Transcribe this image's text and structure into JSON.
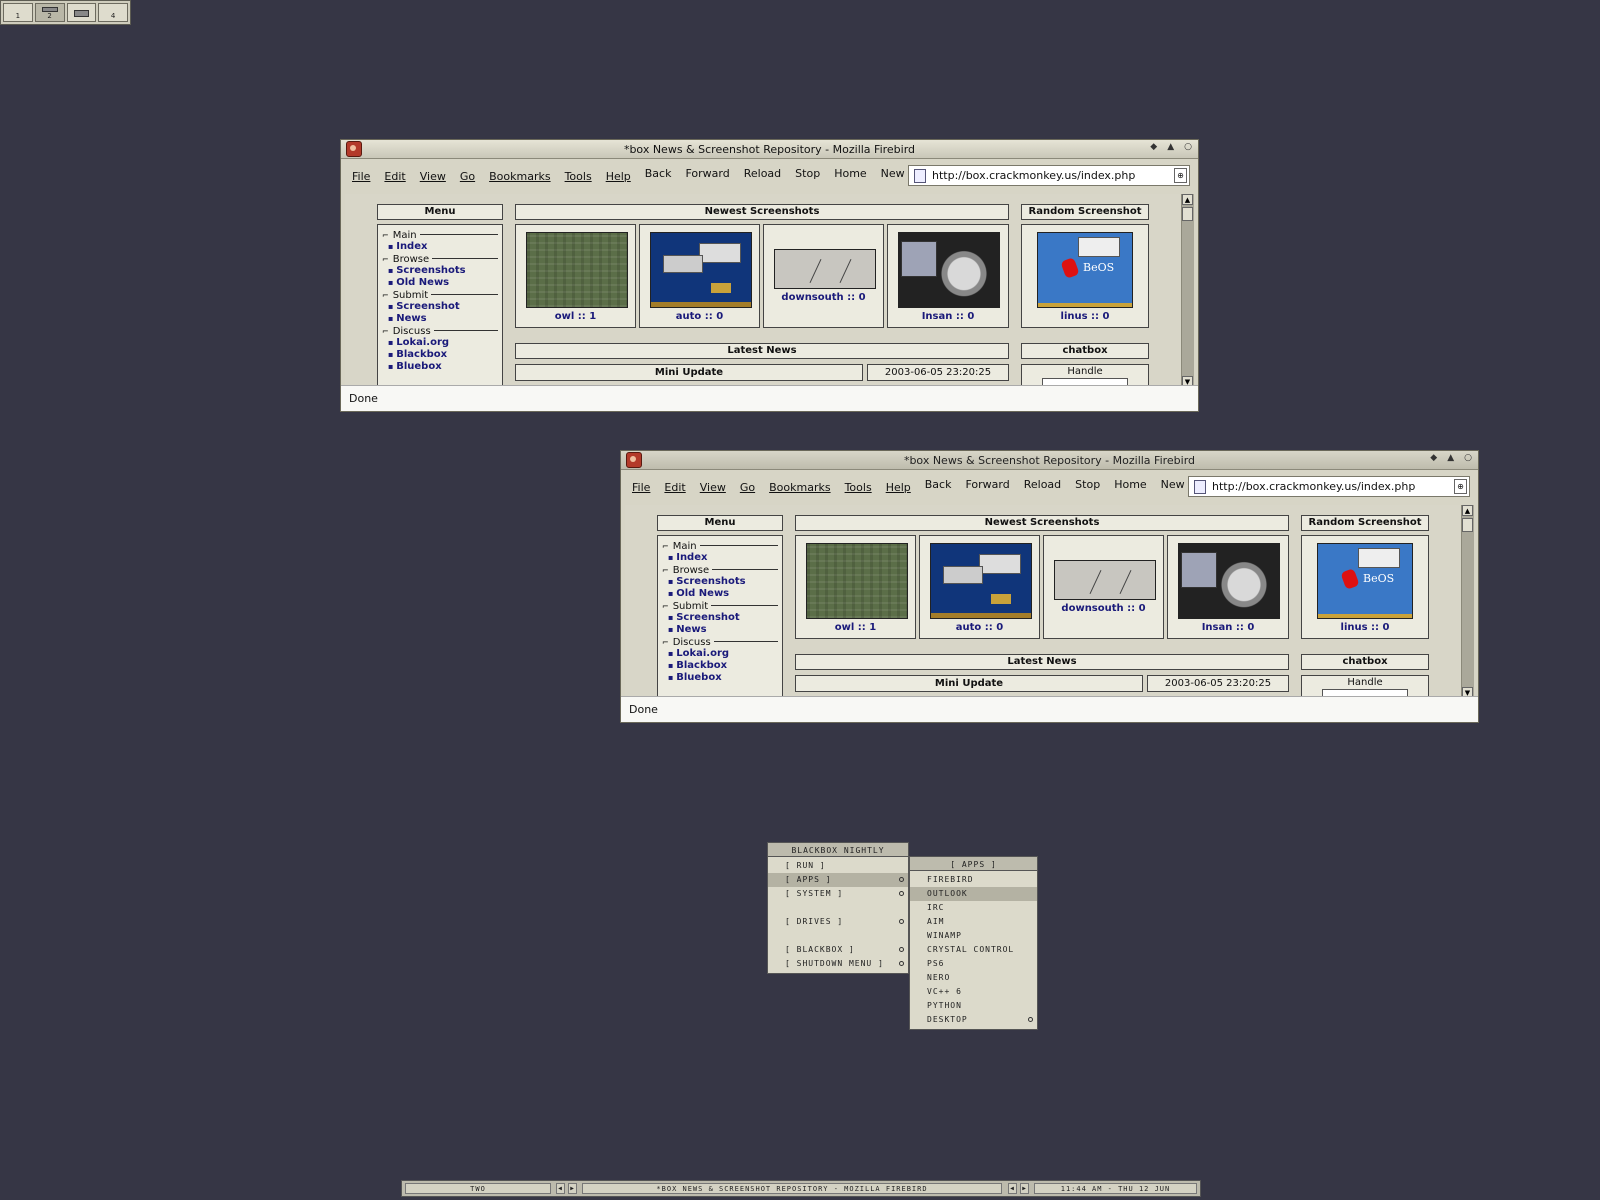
{
  "pager": {
    "desktops": [
      "1",
      "2",
      "",
      "4"
    ]
  },
  "browser": {
    "title": "*box News & Screenshot Repository - Mozilla Firebird",
    "menus": [
      "File",
      "Edit",
      "View",
      "Go",
      "Bookmarks",
      "Tools",
      "Help"
    ],
    "nav": [
      "Back",
      "Forward",
      "Reload",
      "Stop",
      "Home",
      "New Tab"
    ],
    "url": "http://box.crackmonkey.us/index.php",
    "status": "Done",
    "page": {
      "menu_title": "Menu",
      "menu": [
        {
          "section": "Main",
          "links": [
            "Index"
          ]
        },
        {
          "section": "Browse",
          "links": [
            "Screenshots",
            "Old News"
          ]
        },
        {
          "section": "Submit",
          "links": [
            "Screenshot",
            "News"
          ]
        },
        {
          "section": "Discuss",
          "links": [
            "Lokai.org",
            "Blackbox",
            "Bluebox"
          ]
        }
      ],
      "newest_title": "Newest Screenshots",
      "shots": [
        "owl :: 1",
        "auto :: 0",
        "downsouth :: 0",
        "Insan :: 0"
      ],
      "random_title": "Random Screenshot",
      "random_shot": "linus :: 0",
      "random_thumb_text": "BeOS",
      "latest_news_title": "Latest News",
      "news_item": "Mini Update",
      "news_date": "2003-06-05 23:20:25",
      "chatbox_title": "chatbox",
      "chat_handle": "Handle"
    }
  },
  "rootmenu": {
    "title": "BLACKBOX NIGHTLY",
    "items": [
      "[ RUN ]",
      "[ APPS ]",
      "[ SYSTEM ]",
      "[ DRIVES ]",
      "[ BLACKBOX ]",
      "[ SHUTDOWN MENU ]"
    ]
  },
  "appsmenu": {
    "title": "[ APPS ]",
    "items": [
      "FIREBIRD",
      "OUTLOOK",
      "IRC",
      "AIM",
      "WINAMP",
      "CRYSTAL CONTROL",
      "PS6",
      "NERO",
      "VC++ 6",
      "PYTHON",
      "DESKTOP"
    ]
  },
  "toolbar": {
    "workspace": "TWO",
    "window": "*BOX NEWS & SCREENSHOT REPOSITORY - MOZILLA FIREBIRD",
    "clock": "11:44 AM - THU 12 JUN"
  }
}
